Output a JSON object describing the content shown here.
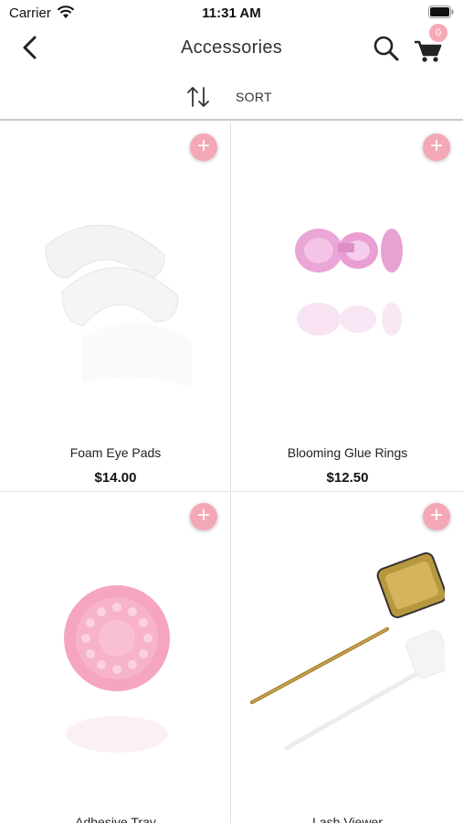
{
  "status_bar": {
    "carrier": "Carrier",
    "time": "11:31 AM"
  },
  "nav": {
    "title": "Accessories",
    "back_icon": "chevron-left-icon",
    "search_icon": "search-icon",
    "cart_icon": "cart-icon",
    "cart_count": "0"
  },
  "sort": {
    "label": "SORT",
    "icon": "sort-arrows-icon"
  },
  "colors": {
    "accent_pink": "#f4a8b6",
    "divider": "#c8c8c8"
  },
  "products": [
    {
      "name": "Foam Eye Pads",
      "price": "$14.00",
      "add_icon": "plus-icon"
    },
    {
      "name": "Blooming Glue Rings",
      "price": "$12.50",
      "add_icon": "plus-icon"
    },
    {
      "name": "Adhesive Tray",
      "price": "",
      "add_icon": "plus-icon"
    },
    {
      "name": "Lash Viewer",
      "price": "",
      "add_icon": "plus-icon"
    }
  ]
}
